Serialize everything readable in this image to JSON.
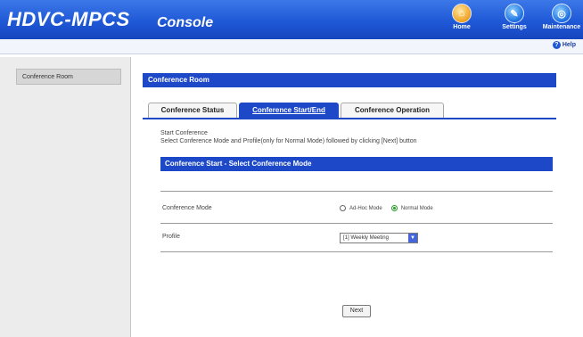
{
  "header": {
    "brand": "HDVC-MPCS",
    "section": "Console",
    "buttons": [
      {
        "label": "Home",
        "icon": "home-icon"
      },
      {
        "label": "Settings",
        "icon": "wrench-icon"
      },
      {
        "label": "Maintenance",
        "icon": "maintenance-icon"
      }
    ],
    "help_label": "Help"
  },
  "sidebar": {
    "items": [
      {
        "label": "Conference Room"
      }
    ]
  },
  "main": {
    "title": "Conference Room",
    "tabs": [
      {
        "label": "Conference Status",
        "active": false
      },
      {
        "label": "Conference Start/End",
        "active": true
      },
      {
        "label": "Conference Operation",
        "active": false
      }
    ],
    "intro_line1": "Start Conference",
    "intro_line2": "Select Conference Mode and Profile(only for Normal Mode) followed by clicking [Next] button",
    "section_title": "Conference Start - Select Conference Mode",
    "mode_label": "Conference Mode",
    "mode_options": [
      {
        "label": "Ad-Hoc Mode",
        "selected": false
      },
      {
        "label": "Normal Mode",
        "selected": true
      }
    ],
    "profile_label": "Profile",
    "profile_value": "[1] Weekly Meeting",
    "next_label": "Next"
  },
  "colors": {
    "accent": "#1d48c8",
    "header": "#1f58d6",
    "selected_radio": "#2a9a2a"
  }
}
